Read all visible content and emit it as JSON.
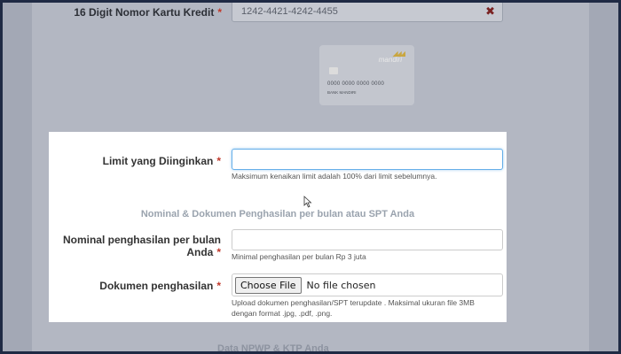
{
  "credit_card": {
    "label": "16 Digit Nomor Kartu Kredit",
    "required_mark": "*",
    "value": "1242-4421-4242-4455",
    "clear_symbol": "✖"
  },
  "card_image": {
    "brand": "mandiri",
    "number": "0000 0000 0000 0000",
    "bank": "BANK MANDIRI"
  },
  "modal": {
    "limit": {
      "label": "Limit yang Diinginkan",
      "required_mark": "*",
      "value": "",
      "help": "Maksimum kenaikan limit adalah 100% dari limit sebelumnya."
    },
    "section_title": "Nominal & Dokumen Penghasilan per bulan atau SPT Anda",
    "income": {
      "label": "Nominal penghasilan per bulan Anda",
      "required_mark": "*",
      "value": "",
      "help": "Minimal penghasilan per bulan Rp 3 juta"
    },
    "document": {
      "label": "Dokumen penghasilan",
      "required_mark": "*",
      "button_label": "Choose File",
      "status": "No file chosen",
      "help_line1": "Upload dokumen penghasilan/SPT terupdate . Maksimal ukuran file 3MB",
      "help_line2": "dengan format .jpg, .pdf, .png."
    }
  },
  "next_section_title": "Data NPWP & KTP Anda"
}
